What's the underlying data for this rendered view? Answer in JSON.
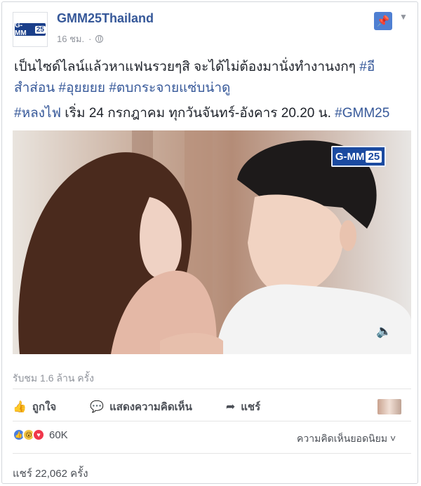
{
  "post": {
    "page_name": "GMM25Thailand",
    "time": "16 ชม.",
    "dot": "·",
    "logo_text": "G-MM",
    "logo_num": "25",
    "text_line1_a": "เป็นไซด์ไลน์แล้วหาแฟนรวยๆสิ จะได้ไม่ต้องมานั่งทำงานงกๆ ",
    "tag1": "#อีสำส่อน",
    "tag2": "#อุยยยย",
    "tag3": "#ตบกระจายแซ่บน่าดู",
    "tag4": "#หลงไฟ",
    "text_line2": " เริ่ม 24 กรกฎาคม ทุกวันจันทร์-อังคาร 20.20 น. ",
    "tag5": "#GMM25"
  },
  "video": {
    "channel_logo_text": "G-MM",
    "channel_logo_num": "25",
    "volume_icon": "speaker-icon",
    "views": "รับชม 1.6 ล้าน ครั้ง"
  },
  "actions": {
    "like_label": "ถูกใจ",
    "comment_label": "แสดงความคิดเห็น",
    "share_label": "แชร์"
  },
  "reactions": {
    "count": "60K",
    "top_comments_label": "ความคิดเห็นยอดนิยม ˅",
    "shares": "แชร์ 22,062 ครั้ง"
  },
  "colors": {
    "link": "#365899",
    "pin": "#4f7fd2",
    "brand": "#1b4aa0"
  }
}
